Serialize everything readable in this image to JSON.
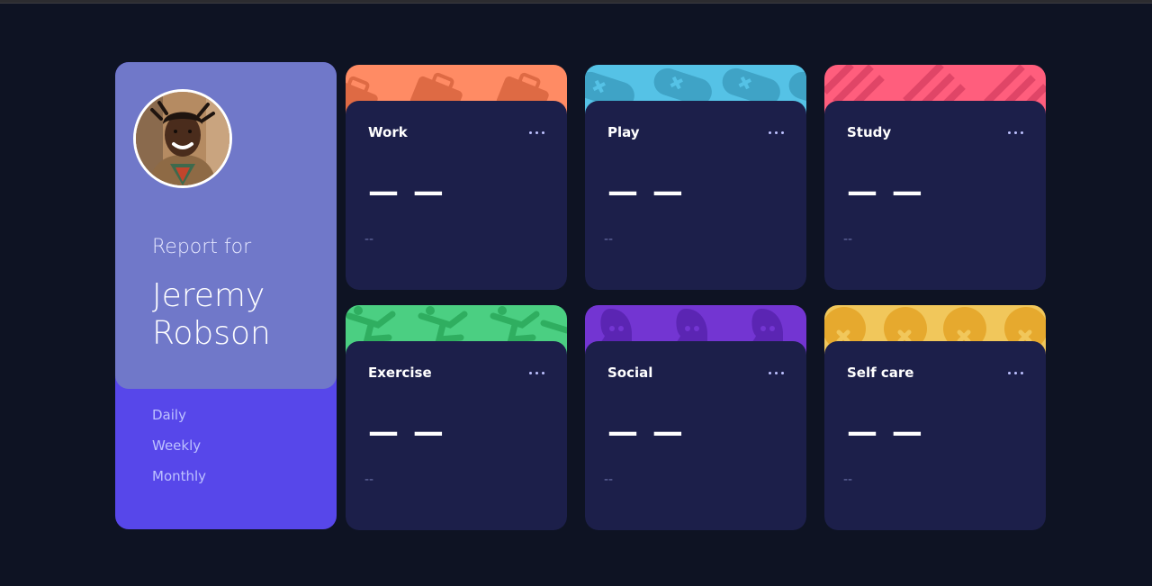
{
  "profile": {
    "report_label": "Report for",
    "name": "Jeremy Robson",
    "periods": [
      "Daily",
      "Weekly",
      "Monthly"
    ]
  },
  "cards": [
    {
      "title": "Work",
      "current": "— —",
      "previous": "--",
      "color": "#ff8b64",
      "icon": "briefcase-pattern"
    },
    {
      "title": "Play",
      "current": "— —",
      "previous": "--",
      "color": "#55c2e6",
      "icon": "gamepad-pattern"
    },
    {
      "title": "Study",
      "current": "— —",
      "previous": "--",
      "color": "#ff5e7d",
      "icon": "book-pattern"
    },
    {
      "title": "Exercise",
      "current": "— —",
      "previous": "--",
      "color": "#4bcf82",
      "icon": "runner-pattern"
    },
    {
      "title": "Social",
      "current": "— —",
      "previous": "--",
      "color": "#7335d2",
      "icon": "chat-pattern"
    },
    {
      "title": "Self care",
      "current": "— —",
      "previous": "--",
      "color": "#f1c75b",
      "icon": "heart-pattern"
    }
  ],
  "theme": {
    "background": "#0e1323",
    "profile_bg": "#5747ea",
    "profile_top_bg": "#7078c9",
    "card_bg": "#1c1f4a"
  }
}
